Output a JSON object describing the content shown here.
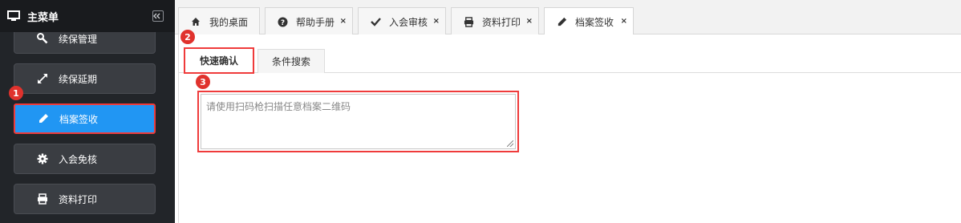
{
  "sidebar": {
    "title": "主菜单",
    "items": [
      {
        "label": "续保管理",
        "icon": "wrench-icon"
      },
      {
        "label": "续保延期",
        "icon": "expand-arrows-icon"
      },
      {
        "label": "档案签收",
        "icon": "pencil-icon",
        "active": true
      },
      {
        "label": "入会免核",
        "icon": "gear-icon"
      },
      {
        "label": "资料打印",
        "icon": "printer-icon"
      }
    ]
  },
  "tabs": [
    {
      "label": "我的桌面",
      "icon": "home-icon",
      "closable": false
    },
    {
      "label": "帮助手册",
      "icon": "question-circle-icon",
      "closable": true
    },
    {
      "label": "入会审核",
      "icon": "check-icon",
      "closable": true
    },
    {
      "label": "资料打印",
      "icon": "printer-icon",
      "closable": true
    },
    {
      "label": "档案签收",
      "icon": "pencil-icon",
      "closable": true,
      "active": true
    }
  ],
  "close_glyph": "×",
  "subtabs": [
    {
      "label": "快速确认",
      "active": true
    },
    {
      "label": "条件搜索"
    }
  ],
  "scan": {
    "placeholder": "请使用扫码枪扫描任意档案二维码",
    "value": ""
  },
  "callouts": [
    "1",
    "2",
    "3"
  ],
  "colors": {
    "sidebar_bg": "#222529",
    "active_blue": "#2196f3",
    "highlight_red": "#ef3b3b"
  }
}
